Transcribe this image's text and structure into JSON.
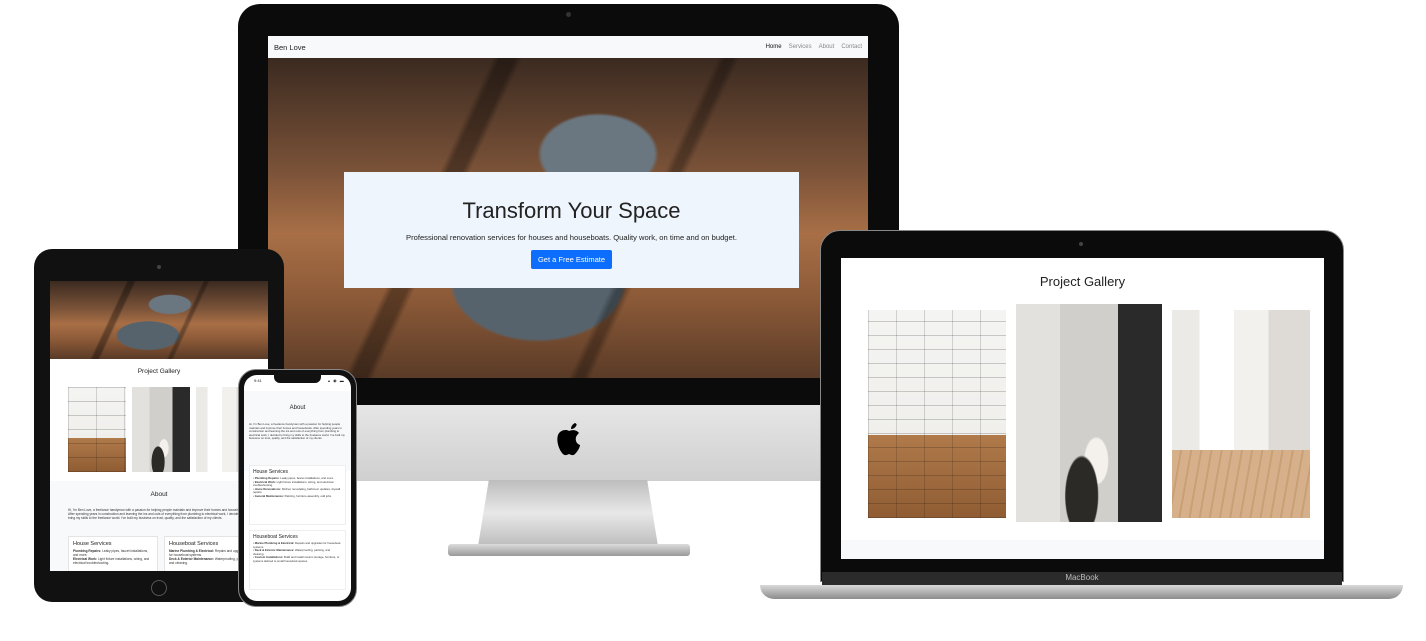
{
  "site": {
    "brand": "Ben Love",
    "nav": [
      "Home",
      "Services",
      "About",
      "Contact"
    ]
  },
  "hero": {
    "title": "Transform Your Space",
    "subtitle": "Professional renovation services for houses and houseboats. Quality work, on time and on budget.",
    "cta": "Get a Free Estimate"
  },
  "gallery": {
    "title": "Project Gallery"
  },
  "about": {
    "title": "About",
    "body": "Hi, I'm Ben Love, a freelance handyman with a passion for helping people maintain and improve their homes and houseboats. After spending years in construction and learning the ins and outs of everything from plumbing to electrical work, I decided to bring my skills to the freelance world. I've built my business on trust, quality, and the satisfaction of my clients."
  },
  "house_services": {
    "title": "House Services",
    "items": [
      {
        "name": "Plumbing Repairs:",
        "desc": "Leaky pipes, faucet installations, and more."
      },
      {
        "name": "Electrical Work:",
        "desc": "Light fixture installations, wiring, and electrical troubleshooting."
      },
      {
        "name": "Home Renovations:",
        "desc": "Kitchen remodeling, bathroom updates, drywall repairs."
      },
      {
        "name": "General Maintenance:",
        "desc": "Painting, furniture assembly, odd jobs."
      }
    ]
  },
  "houseboat_services": {
    "title": "Houseboat Services",
    "items": [
      {
        "name": "Marine Plumbing & Electrical:",
        "desc": "Repairs and upgrades for houseboat systems."
      },
      {
        "name": "Deck & Exterior Maintenance:",
        "desc": "Waterproofing, painting, and cleaning."
      },
      {
        "name": "Custom Installations:",
        "desc": "Build and install custom storage, furniture, or systems tailored to small houseboat spaces."
      }
    ]
  },
  "devices": {
    "laptop_label": "MacBook",
    "phone_time": "9:41"
  },
  "colors": {
    "accent": "#0d6efd",
    "hero_card": "#eef5fc",
    "navbar": "#f8f9fa"
  }
}
